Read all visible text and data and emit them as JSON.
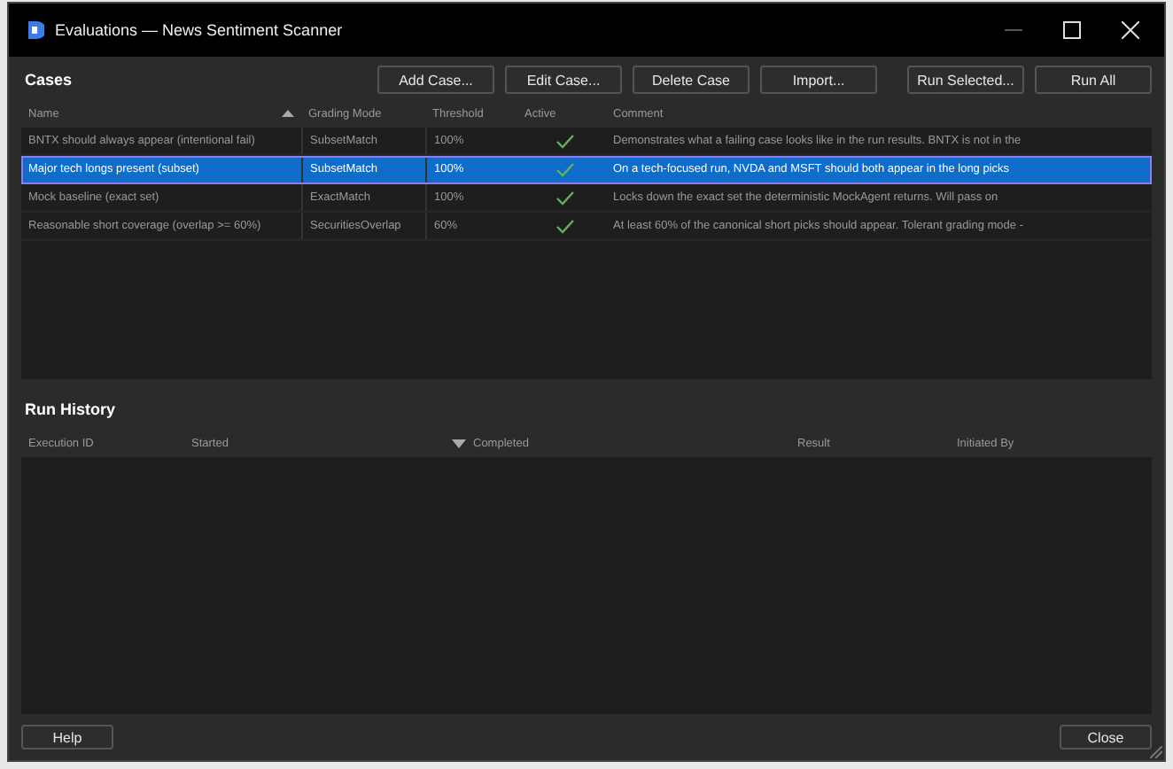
{
  "window": {
    "title": "Evaluations — News Sentiment Scanner"
  },
  "cases": {
    "title": "Cases",
    "buttons": [
      "Add Case...",
      "Edit Case...",
      "Delete Case",
      "Import...",
      "Run Selected...",
      "Run All"
    ],
    "columns": [
      "Name",
      "Grading Mode",
      "Threshold",
      "Active",
      "Comment"
    ],
    "rows": [
      {
        "name": "BNTX should always appear (intentional fail)",
        "mode": "SubsetMatch",
        "threshold": "100%",
        "active": true,
        "comment": "Demonstrates what a failing case looks like in the run results. BNTX is not in the",
        "selected": false
      },
      {
        "name": "Major tech longs present (subset)",
        "mode": "SubsetMatch",
        "threshold": "100%",
        "active": true,
        "comment": "On a tech-focused run, NVDA and MSFT should both appear in the long picks",
        "selected": true
      },
      {
        "name": "Mock baseline (exact set)",
        "mode": "ExactMatch",
        "threshold": "100%",
        "active": true,
        "comment": "Locks down the exact set the deterministic MockAgent returns. Will pass on",
        "selected": false
      },
      {
        "name": "Reasonable short coverage (overlap >= 60%)",
        "mode": "SecuritiesOverlap",
        "threshold": "60%",
        "active": true,
        "comment": "At least 60% of the canonical short picks should appear. Tolerant grading mode -",
        "selected": false
      }
    ]
  },
  "run_history": {
    "title": "Run History",
    "columns": [
      "Execution ID",
      "Started",
      "Completed",
      "Result",
      "Initiated By"
    ]
  },
  "footer": {
    "help": "Help",
    "close": "Close"
  }
}
